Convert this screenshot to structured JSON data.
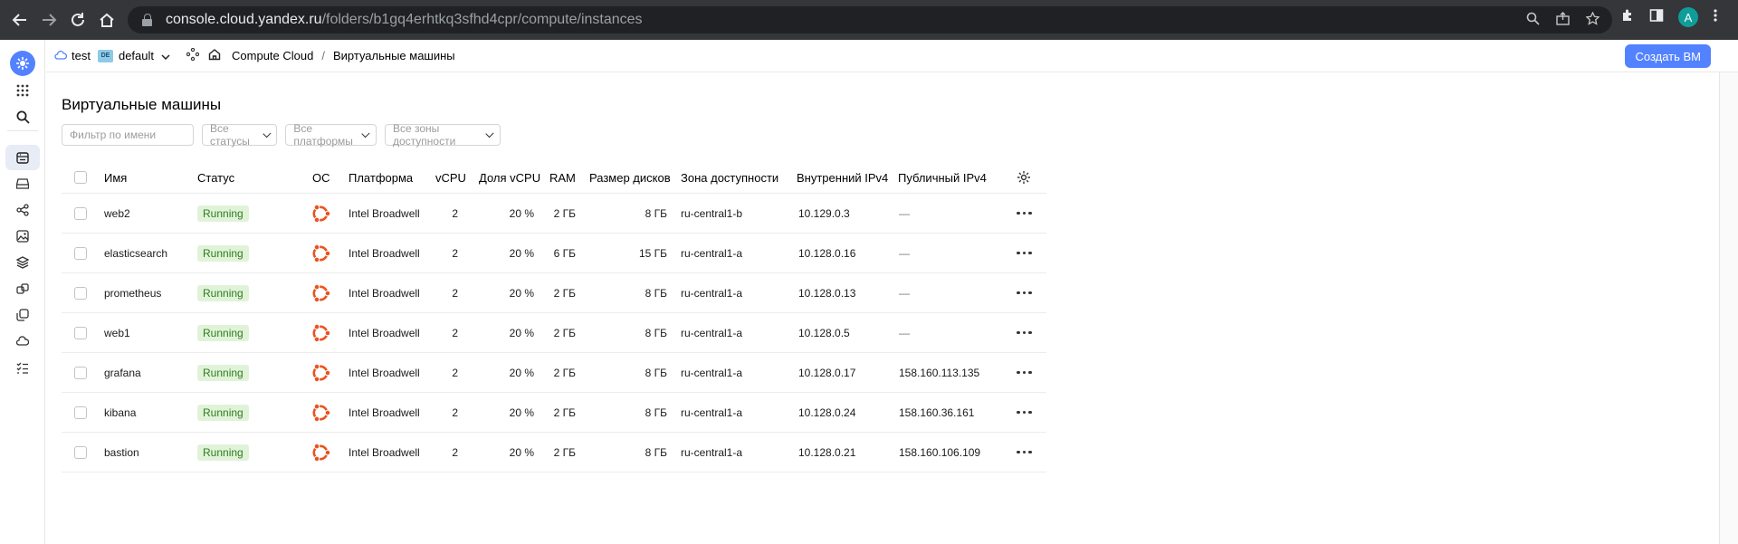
{
  "browser": {
    "url_host": "console.cloud.yandex.ru",
    "url_path": "/folders/b1gq4erhtkq3sfhd4cpr/compute/instances",
    "avatar_letter": "A"
  },
  "breadcrumbs": {
    "cloud": "test",
    "folder_badge": "DE",
    "folder": "default",
    "service": "Compute Cloud",
    "separator": "/",
    "page": "Виртуальные машины"
  },
  "header": {
    "create_button": "Создать ВМ"
  },
  "page": {
    "title": "Виртуальные машины"
  },
  "filters": {
    "name_placeholder": "Фильтр по имени",
    "status": "Все статусы",
    "platform": "Все платформы",
    "zone": "Все зоны доступности"
  },
  "table": {
    "columns": [
      "Имя",
      "Статус",
      "ОС",
      "Платформа",
      "vCPU",
      "Доля vCPU",
      "RAM",
      "Размер дисков",
      "Зона доступности",
      "Внутренний IPv4",
      "Публичный IPv4"
    ],
    "rows": [
      {
        "name": "web2",
        "status": "Running",
        "platform": "Intel Broadwell",
        "vcpu": "2",
        "share": "20 %",
        "ram": "2 ГБ",
        "disk": "8 ГБ",
        "zone": "ru-central1-b",
        "ipv4": "10.129.0.3",
        "public": "—"
      },
      {
        "name": "elasticsearch",
        "status": "Running",
        "platform": "Intel Broadwell",
        "vcpu": "2",
        "share": "20 %",
        "ram": "6 ГБ",
        "disk": "15 ГБ",
        "zone": "ru-central1-a",
        "ipv4": "10.128.0.16",
        "public": "—"
      },
      {
        "name": "prometheus",
        "status": "Running",
        "platform": "Intel Broadwell",
        "vcpu": "2",
        "share": "20 %",
        "ram": "2 ГБ",
        "disk": "8 ГБ",
        "zone": "ru-central1-a",
        "ipv4": "10.128.0.13",
        "public": "—"
      },
      {
        "name": "web1",
        "status": "Running",
        "platform": "Intel Broadwell",
        "vcpu": "2",
        "share": "20 %",
        "ram": "2 ГБ",
        "disk": "8 ГБ",
        "zone": "ru-central1-a",
        "ipv4": "10.128.0.5",
        "public": "—"
      },
      {
        "name": "grafana",
        "status": "Running",
        "platform": "Intel Broadwell",
        "vcpu": "2",
        "share": "20 %",
        "ram": "2 ГБ",
        "disk": "8 ГБ",
        "zone": "ru-central1-a",
        "ipv4": "10.128.0.17",
        "public": "158.160.113.135"
      },
      {
        "name": "kibana",
        "status": "Running",
        "platform": "Intel Broadwell",
        "vcpu": "2",
        "share": "20 %",
        "ram": "2 ГБ",
        "disk": "8 ГБ",
        "zone": "ru-central1-a",
        "ipv4": "10.128.0.24",
        "public": "158.160.36.161"
      },
      {
        "name": "bastion",
        "status": "Running",
        "platform": "Intel Broadwell",
        "vcpu": "2",
        "share": "20 %",
        "ram": "2 ГБ",
        "disk": "8 ГБ",
        "zone": "ru-central1-a",
        "ipv4": "10.128.0.21",
        "public": "158.160.106.109"
      }
    ]
  },
  "colors": {
    "accent": "#5282ff",
    "running_bg": "#e0f3d9",
    "running_text": "#2f7d1d",
    "ubuntu": "#e95420"
  }
}
